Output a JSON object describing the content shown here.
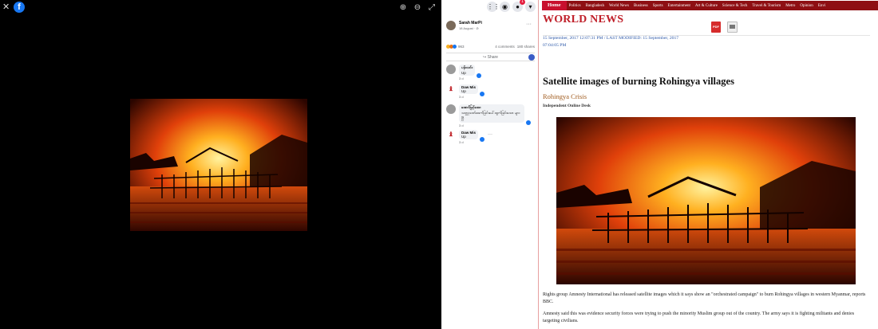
{
  "viewer": {
    "close_glyph": "✕",
    "logo_letter": "f",
    "tools": [
      {
        "name": "zoom-in-icon",
        "glyph": "⊕"
      },
      {
        "name": "zoom-out-icon",
        "glyph": "⊖"
      },
      {
        "name": "fullscreen-icon",
        "glyph": "⤢"
      }
    ]
  },
  "sidebar": {
    "top_icons": [
      {
        "name": "menu-grid-icon",
        "glyph": "⋮⋮"
      },
      {
        "name": "messenger-icon",
        "glyph": "◉"
      },
      {
        "name": "notifications-icon",
        "glyph": "●",
        "badge": "1"
      },
      {
        "name": "account-dropdown-icon",
        "glyph": "▾"
      }
    ],
    "post": {
      "author": "Sarah MarPi",
      "date": "18 August · ⊘",
      "reaction_count": "963",
      "comments": "4 comments",
      "shares": "180 shares",
      "share_label": "↪ Share"
    },
    "comments": [
      {
        "name": "ပန်းသင်း",
        "text": "Up",
        "time": "3 d",
        "likes": "2",
        "avatar": "grey"
      },
      {
        "name": "Daw Mis",
        "text": "Up",
        "time": "3 d",
        "likes": "2",
        "avatar": "red"
      },
      {
        "name": "အောင်မြင့်အေး",
        "text": "သတ္တုသတ်ဖဖက်ခြင်းပေါ်ထွက်ခြင်းသော များပြီ",
        "time": "3 d",
        "likes": "2",
        "avatar": "grey"
      },
      {
        "name": "Daw Mis",
        "text": "Up",
        "time": "3 d",
        "likes": "1",
        "avatar": "red"
      }
    ]
  },
  "news": {
    "nav": [
      "Home",
      "Politics",
      "Bangladesh",
      "World News",
      "Business",
      "Sports",
      "Entertainment",
      "Art & Culture",
      "Science & Tech",
      "Travel & Tourism",
      "Metro",
      "Opinion",
      "Envi"
    ],
    "section": "WORLD NEWS",
    "pdf_label": "PDF",
    "timestamp": "15 September, 2017 12:07:31 PM / LAST MODIFIED: 15 September, 2017 07:04:05 PM",
    "headline": "Satellite images of burning Rohingya villages",
    "kicker": "Rohingya Crisis",
    "byline": "Independent Online Desk",
    "paragraphs": [
      "Rights group Amnesty International has released satellite images which it says show an \"orchestrated campaign\" to burn Rohingya villages in western Myanmar, reports BBC.",
      "Amnesty said this was evidence security forces were trying to push the minority Muslim group out of the country. The army says it is fighting militants and denies targeting civilians."
    ]
  },
  "colors": {
    "fb_blue": "#1877f2",
    "news_red": "#c0202a",
    "nav_bg": "#8e0f13"
  }
}
